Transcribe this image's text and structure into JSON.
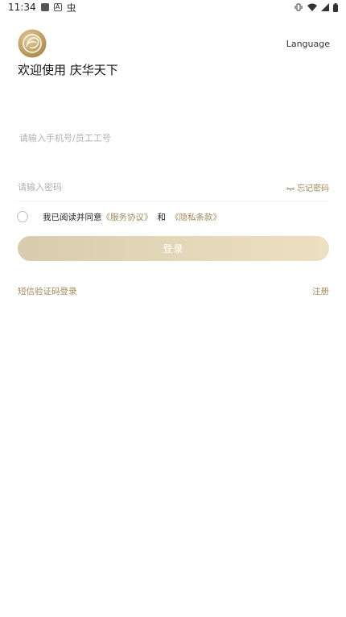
{
  "status_bar": {
    "time": "11:34",
    "app_icons": [
      "square-app-icon",
      "a-app-icon",
      "bug-icon"
    ],
    "system_icons": [
      "vibrate-icon",
      "wifi-icon",
      "signal-icon",
      "battery-icon"
    ],
    "bug_glyph": "虫"
  },
  "header": {
    "logo_icon": "qinghua-logo-icon",
    "language_label": "Language",
    "welcome_text": "欢迎使用 庆华天下"
  },
  "form": {
    "phone_placeholder": "请输入手机号/员工工号",
    "password_placeholder": "请输入密码",
    "forgot_label": "忘记密码",
    "agree_prefix": "我已阅读并同意",
    "service_agreement": "《服务协议》",
    "and_text": "和",
    "privacy_policy": "《隐私条款》",
    "login_label": "登录"
  },
  "footer_links": {
    "sms_login": "短信验证码登录",
    "register": "注册"
  },
  "colors": {
    "accent_gold": "#a38a5a",
    "button_gradient_start": "#d9ccae",
    "button_gradient_end": "#ede0c2",
    "placeholder": "#b0b0b0"
  }
}
